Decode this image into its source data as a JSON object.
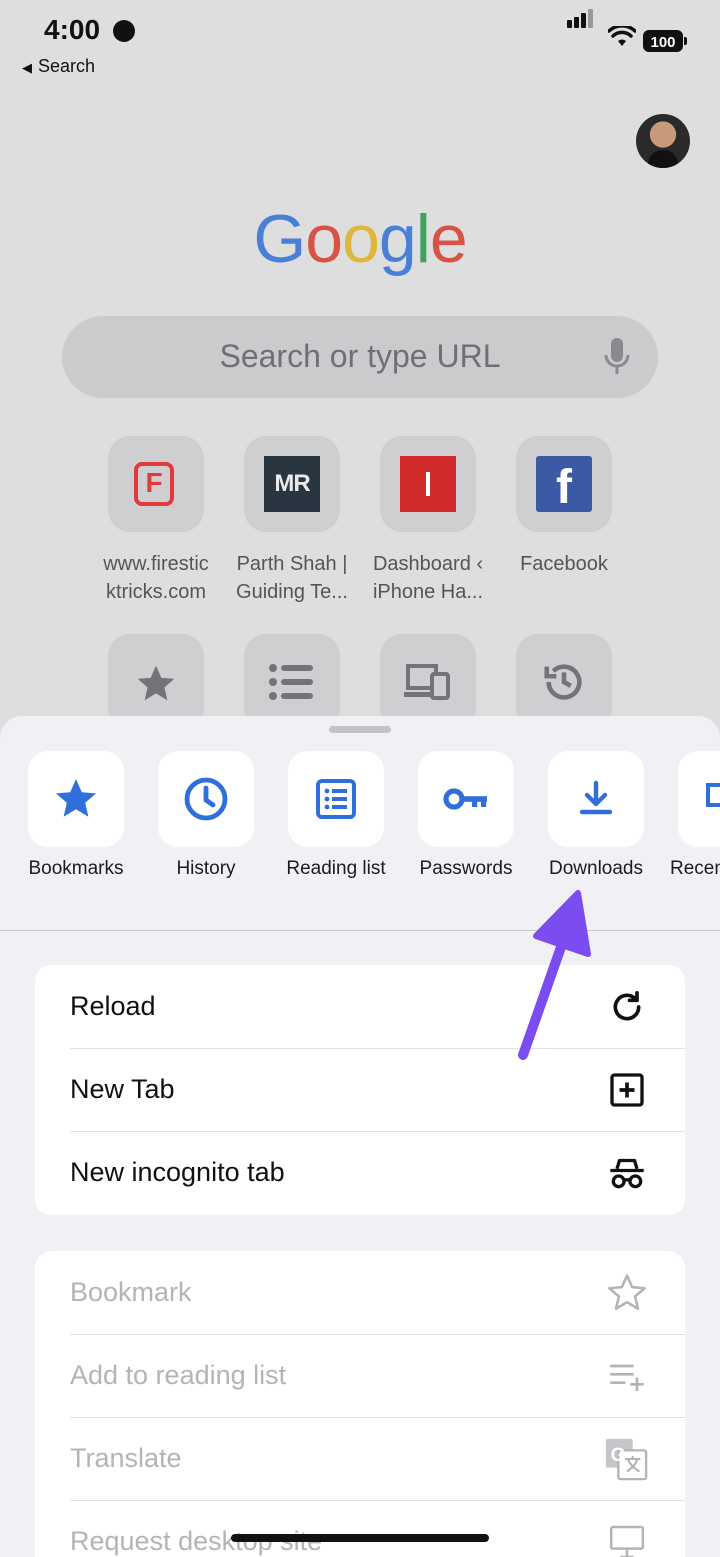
{
  "status_bar": {
    "time": "4:00",
    "back_label": "Search",
    "battery": "100"
  },
  "google_logo": [
    "G",
    "o",
    "o",
    "g",
    "l",
    "e"
  ],
  "search": {
    "placeholder": "Search or type URL"
  },
  "shortcuts": [
    {
      "line1": "www.firestic",
      "line2": "ktricks.com"
    },
    {
      "line1": "Parth Shah |",
      "line2": "Guiding Te..."
    },
    {
      "line1": "Dashboard ‹",
      "line2": "iPhone Ha..."
    },
    {
      "line1": "Facebook",
      "line2": ""
    }
  ],
  "favicons": {
    "mr": "MR",
    "fb": "f",
    "ff": "F"
  },
  "quick_actions": [
    {
      "label": "Bookmarks",
      "icon": "star-icon"
    },
    {
      "label": "History",
      "icon": "clock-icon"
    },
    {
      "label": "Reading list",
      "icon": "list-icon"
    },
    {
      "label": "Passwords",
      "icon": "key-icon"
    },
    {
      "label": "Downloads",
      "icon": "download-icon"
    },
    {
      "label": "Recent tabs",
      "icon": "devices-icon"
    }
  ],
  "menu_primary": [
    {
      "label": "Reload",
      "icon": "reload-icon"
    },
    {
      "label": "New Tab",
      "icon": "new-tab-icon"
    },
    {
      "label": "New incognito tab",
      "icon": "incognito-icon"
    }
  ],
  "menu_secondary": [
    {
      "label": "Bookmark",
      "icon": "star-outline-icon"
    },
    {
      "label": "Add to reading list",
      "icon": "add-list-icon"
    },
    {
      "label": "Translate",
      "icon": "translate-icon"
    },
    {
      "label": "Request desktop site",
      "icon": "desktop-icon"
    }
  ],
  "colors": {
    "accent": "#2f6fdb",
    "annotation_arrow": "#7b4cf0"
  }
}
